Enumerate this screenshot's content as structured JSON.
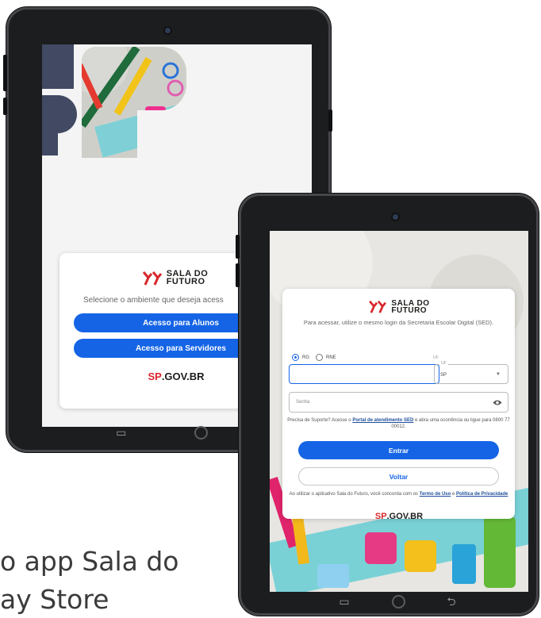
{
  "background": {
    "line1": "o app Sala do",
    "line2": "ay Store"
  },
  "tablet_left": {
    "card": {
      "logo_line1": "SALA DO",
      "logo_line2": "FUTURO",
      "prompt": "Selecione o ambiente que deseja acess",
      "btn_students": "Acesso para Alunos",
      "btn_staff": "Acesso para Servidores",
      "gov_sp": "SP",
      "gov_text": ".GOV.BR"
    }
  },
  "tablet_right": {
    "card": {
      "logo_line1": "SALA DO",
      "logo_line2": "FUTURO",
      "intro": "Para acessar, utilize o mesmo login da Secretaria Escolar Digital (SED).",
      "radio_rg": "RG",
      "radio_rne": "RNE",
      "uf_label_top": "UF",
      "uf_label": "UF",
      "uf_value": "SP",
      "password_placeholder": "Senha",
      "support_pre": "Precisa de Suporte? Acesse o ",
      "support_link": "Portal de atendimento SED",
      "support_post": " e abra uma ocorrência ou ligue para 0800 77 00012.",
      "btn_enter": "Entrar",
      "btn_back": "Voltar",
      "terms_pre": "Ao utilizar o aplicativo Sala do Futuro, você concorda com os ",
      "terms_link": "Termo de Uso",
      "terms_mid": " e ",
      "privacy_link": "Política de Privacidade",
      "gov_sp": "SP",
      "gov_text": ".GOV.BR"
    }
  },
  "icons": {
    "nav_recent": "recent-apps-icon",
    "nav_home": "home-icon",
    "nav_back": "back-icon",
    "eye": "eye-icon",
    "dropdown": "chevron-down-icon"
  },
  "colors": {
    "primary": "#1564e6",
    "link": "#1f4f9a",
    "logo_red": "#d8262b",
    "tablet_frame": "#1c1d1f"
  }
}
